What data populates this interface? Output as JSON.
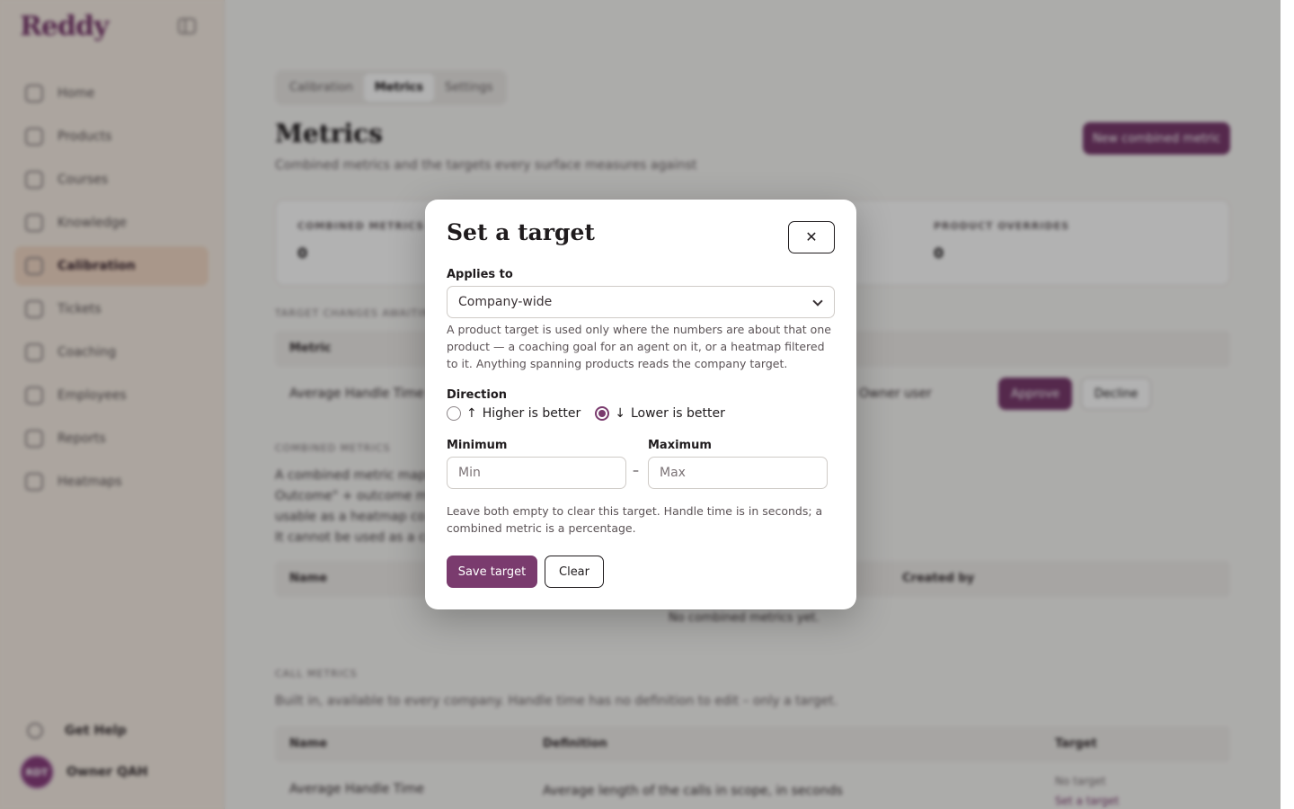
{
  "app": {
    "logo": "Reddy"
  },
  "sidebar": {
    "items": [
      {
        "label": "Home",
        "icon": "home-icon"
      },
      {
        "label": "Products",
        "icon": "products-icon"
      },
      {
        "label": "Courses",
        "icon": "courses-icon"
      },
      {
        "label": "Knowledge",
        "icon": "knowledge-icon"
      },
      {
        "label": "Calibration",
        "icon": "calibration-icon",
        "active": true
      },
      {
        "label": "Tickets",
        "icon": "tickets-icon"
      },
      {
        "label": "Coaching",
        "icon": "coaching-icon"
      },
      {
        "label": "Employees",
        "icon": "employees-icon"
      },
      {
        "label": "Reports",
        "icon": "reports-icon"
      },
      {
        "label": "Heatmaps",
        "icon": "heatmaps-icon"
      }
    ],
    "help_label": "Get Help",
    "user_initials": "RDT",
    "user_name": "Owner QAH"
  },
  "main": {
    "tabs": [
      "Calibration",
      "Metrics",
      "Settings"
    ],
    "active_tab": "Metrics",
    "title": "Metrics",
    "subtitle": "Combined metrics and the targets every surface measures against",
    "new_button": "New combined metric",
    "stats": [
      {
        "label": "COMBINED METRICS",
        "value": "0"
      },
      {
        "label": "PRODUCT OVERRIDES",
        "value": "0"
      }
    ],
    "target_changes_label": "TARGET CHANGES AWAITING",
    "target_changes_header": "Metric",
    "target_row_metric": "Average Handle Time",
    "target_row_by": "Owner user",
    "approve_label": "Approve",
    "decline_label": "Decline",
    "combined_label": "COMBINED METRICS",
    "combined_para": [
      "A combined metric maps",
      "Outcome\" + outcome m",
      "usable as a heatmap co",
      "It cannot be used as a co"
    ],
    "combined_head_name": "Name",
    "combined_head_created": "Created by",
    "combined_empty": "No combined metrics yet.",
    "call_label": "CALL METRICS",
    "call_para": "Built in, available to every company. Handle time has no definition to edit – only a target.",
    "call_head": {
      "name": "Name",
      "definition": "Definition",
      "target": "Target"
    },
    "call_row": {
      "name": "Average Handle Time",
      "definition": "Average length of the calls in scope, in seconds",
      "target": "No target",
      "target_link": "Set a target"
    }
  },
  "modal": {
    "title": "Set a target",
    "close_icon": "close-icon",
    "applies_label": "Applies to",
    "applies_value": "Company-wide",
    "applies_help": "A product target is used only where the numbers are about that one product — a coaching goal for an agent on it, or a heatmap filtered to it. Anything spanning products reads the company target.",
    "direction_label": "Direction",
    "direction_options": [
      {
        "label": "Higher is better",
        "arrow": "↑",
        "checked": false
      },
      {
        "label": "Lower is better",
        "arrow": "↓",
        "checked": true
      }
    ],
    "min_label": "Minimum",
    "min_placeholder": "Min",
    "max_label": "Maximum",
    "max_placeholder": "Max",
    "range_dash": "–",
    "range_help": "Leave both empty to clear this target. Handle time is in seconds; a combined metric is a percentage.",
    "save_label": "Save target",
    "clear_label": "Clear"
  },
  "colors": {
    "accent": "#7a3b6e",
    "sidebar_active": "#f3d9c6"
  }
}
